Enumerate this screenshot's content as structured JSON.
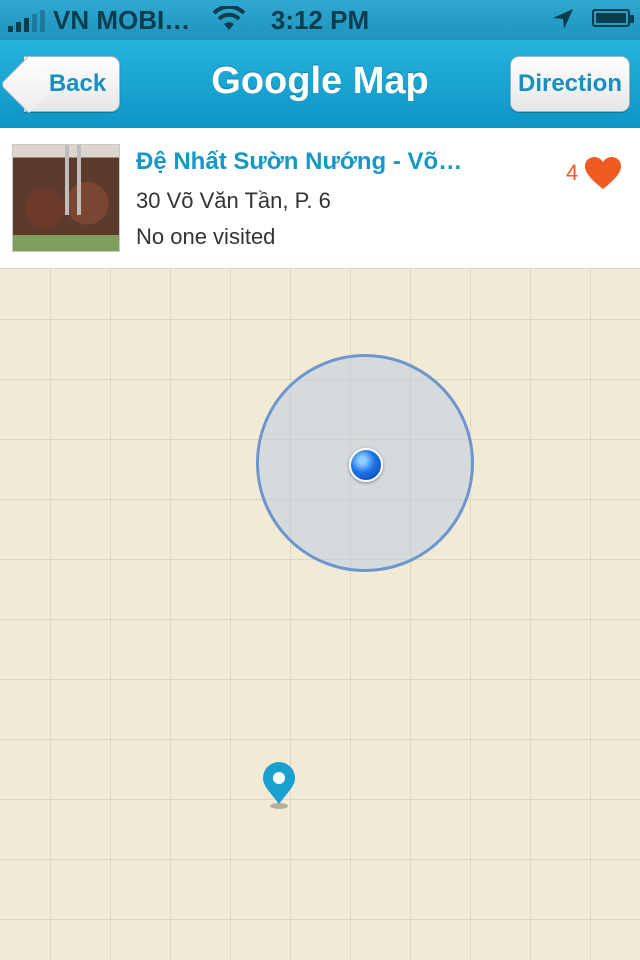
{
  "status_bar": {
    "carrier": "VN MOBI…",
    "time": "3:12 PM"
  },
  "nav": {
    "title": "Google Map",
    "back_label": "Back",
    "direction_label": "Direction"
  },
  "place": {
    "name": "Đệ Nhất Sườn Nướng - Võ…",
    "address": "30 Võ Văn Tần, P. 6",
    "visits": "No one visited",
    "likes": "4"
  },
  "colors": {
    "nav_bar": "#1aa3d2",
    "accent_text": "#1597c7",
    "like_color": "#f05a23",
    "map_background": "#f1ebd6",
    "map_pin": "#1aa0cf"
  },
  "icons": {
    "heart": "heart-icon",
    "map_pin": "map-pin-icon",
    "user_location": "user-location-icon"
  }
}
